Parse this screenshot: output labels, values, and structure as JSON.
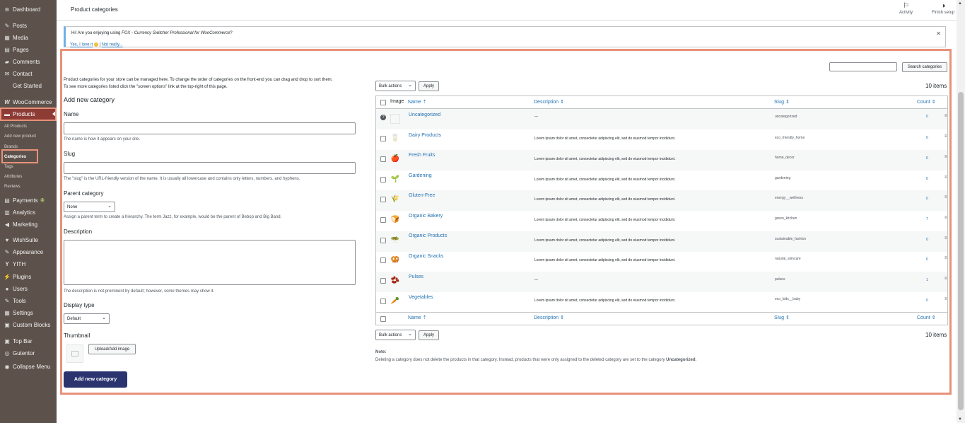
{
  "colors": {
    "sidebar": "#5d524b",
    "active": "#8d3b35",
    "highlight": "#e8917a",
    "link": "#2271b1",
    "primary": "#2c3470"
  },
  "sidebar": {
    "items": [
      {
        "label": "Dashboard",
        "icon": "dashboard-icon",
        "glyph": "⊛"
      },
      {
        "label": "Posts",
        "icon": "pin-icon",
        "glyph": "✎"
      },
      {
        "label": "Media",
        "icon": "media-icon",
        "glyph": "▦"
      },
      {
        "label": "Pages",
        "icon": "page-icon",
        "glyph": "▤"
      },
      {
        "label": "Comments",
        "icon": "comment-icon",
        "glyph": "▰"
      },
      {
        "label": "Contact",
        "icon": "mail-icon",
        "glyph": "✉"
      },
      {
        "label": "Get Started",
        "icon": "",
        "glyph": ""
      },
      {
        "label": "WooCommerce",
        "icon": "woo-icon",
        "glyph": "W"
      },
      {
        "label": "Products",
        "icon": "products-icon",
        "glyph": "▬"
      },
      {
        "label": "Payments",
        "icon": "payments-icon",
        "glyph": "▤"
      },
      {
        "label": "Analytics",
        "icon": "analytics-icon",
        "glyph": "▥"
      },
      {
        "label": "Marketing",
        "icon": "megaphone-icon",
        "glyph": "◀"
      },
      {
        "label": "WishSuite",
        "icon": "heart-icon",
        "glyph": "♥"
      },
      {
        "label": "Appearance",
        "icon": "brush-icon",
        "glyph": "✎"
      },
      {
        "label": "YITH",
        "icon": "yith-icon",
        "glyph": "Y"
      },
      {
        "label": "Plugins",
        "icon": "plug-icon",
        "glyph": "⚡"
      },
      {
        "label": "Users",
        "icon": "user-icon",
        "glyph": "●"
      },
      {
        "label": "Tools",
        "icon": "wrench-icon",
        "glyph": "✎"
      },
      {
        "label": "Settings",
        "icon": "settings-icon",
        "glyph": "▦"
      },
      {
        "label": "Custom Blocks",
        "icon": "blocks-icon",
        "glyph": "▣"
      },
      {
        "label": "Top Bar",
        "icon": "topbar-icon",
        "glyph": "▣"
      },
      {
        "label": "Gutentor",
        "icon": "gutentor-icon",
        "glyph": "◎"
      },
      {
        "label": "Collapse Menu",
        "icon": "collapse-icon",
        "glyph": "◉"
      }
    ],
    "payments_badge": "1",
    "submenu": [
      "All Products",
      "Add new product",
      "Brands",
      "Categories",
      "Tags",
      "Attributes",
      "Reviews"
    ]
  },
  "header": {
    "title": "Product categories",
    "activity": "Activity",
    "finish_setup": "Finish setup"
  },
  "notice": {
    "text_prefix": "Hi! Are you enjoying using ",
    "text_em": "FOX - Currency Switcher Professional for WooCommerce",
    "text_suffix": "?",
    "love": "Yes, I love it",
    "sep": "|",
    "not_really": "Not really...",
    "close": "✕"
  },
  "form": {
    "intro1": "Product categories for your store can be managed here. To change the order of categories on the front-end you can drag and drop to sort them.",
    "intro2": "To see more categories listed click the \"screen options\" link at the top-right of this page.",
    "heading": "Add new category",
    "name_label": "Name",
    "name_help": "The name is how it appears on your site.",
    "slug_label": "Slug",
    "slug_help": "The \"slug\" is the URL-friendly version of the name. It is usually all lowercase and contains only letters, numbers, and hyphens.",
    "parent_label": "Parent category",
    "parent_value": "None",
    "parent_help": "Assign a parent term to create a hierarchy. The term Jazz, for example, would be the parent of Bebop and Big Band.",
    "desc_label": "Description",
    "desc_help": "The description is not prominent by default; however, some themes may show it.",
    "display_label": "Display type",
    "display_value": "Default",
    "thumb_label": "Thumbnail",
    "upload_btn": "Upload/Add image",
    "submit": "Add new category"
  },
  "list": {
    "search_btn": "Search categories",
    "bulk": "Bulk actions",
    "apply": "Apply",
    "count": "10 items",
    "cols": {
      "image": "Image",
      "name": "Name",
      "description": "Description",
      "slug": "Slug",
      "count": "Count"
    },
    "rows": [
      {
        "name": "Uncategorized",
        "desc": "—",
        "slug": "uncategorized",
        "count": "0",
        "thumb": "",
        "help": "?"
      },
      {
        "name": "Dairy Products",
        "desc": "Lorem ipsum dolor sit amet, consectetur adipiscing elit, sed do eiusmod tempor incididunt.",
        "slug": "eco_friendly_home",
        "count": "0",
        "thumb": "🥛"
      },
      {
        "name": "Fresh Fruits",
        "desc": "Lorem ipsum dolor sit amet, consectetur adipiscing elit, sed do eiusmod tempor incididunt.",
        "slug": "home_decor",
        "count": "0",
        "thumb": "🍎"
      },
      {
        "name": "Gardening",
        "desc": "Lorem ipsum dolor sit amet, consectetur adipiscing elit, sed do eiusmod tempor incididunt.",
        "slug": "gardening",
        "count": "0",
        "thumb": "🌱"
      },
      {
        "name": "Gluten-Free",
        "desc": "Lorem ipsum dolor sit amet, consectetur adipiscing elit, sed do eiusmod tempor incididunt.",
        "slug": "energy__wellness",
        "count": "0",
        "thumb": "🌾"
      },
      {
        "name": "Organic Bakery",
        "desc": "Lorem ipsum dolor sit amet, consectetur adipiscing elit, sed do eiusmod tempor incididunt.",
        "slug": "green_kitchen",
        "count": "7",
        "thumb": "🍞"
      },
      {
        "name": "Organic Products",
        "desc": "Lorem ipsum dolor sit amet, consectetur adipiscing elit, sed do eiusmod tempor incididunt.",
        "slug": "sustainable_fashion",
        "count": "0",
        "thumb": "🥗"
      },
      {
        "name": "Organic Snacks",
        "desc": "Lorem ipsum dolor sit amet, consectetur adipiscing elit, sed do eiusmod tempor incididunt.",
        "slug": "natural_skincare",
        "count": "0",
        "thumb": "🥨"
      },
      {
        "name": "Pulses",
        "desc": "—",
        "slug": "pulses",
        "count": "1",
        "thumb": "🫘"
      },
      {
        "name": "Vegetables",
        "desc": "Lorem ipsum dolor sit amet, consectetur adipiscing elit, sed do eiusmod tempor incididunt.",
        "slug": "eco_kids__baby",
        "count": "0",
        "thumb": "🥕"
      }
    ],
    "note_label": "Note:",
    "note_text": "Deleting a category does not delete the products in that category. Instead, products that were only assigned to the deleted category are set to the category ",
    "note_strong": "Uncategorized",
    "note_end": "."
  }
}
